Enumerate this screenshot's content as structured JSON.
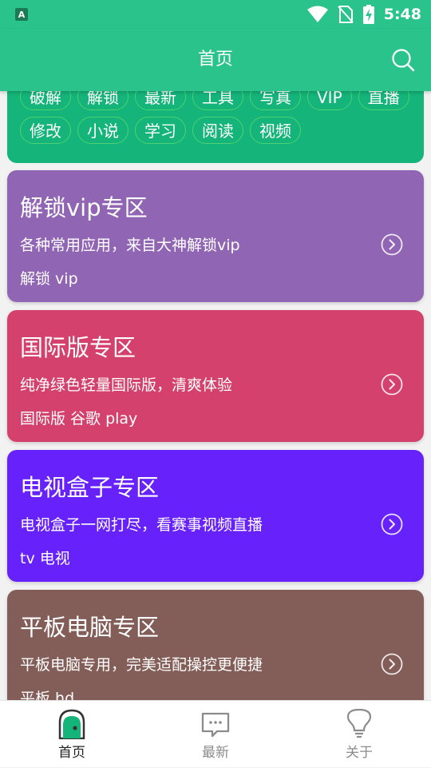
{
  "status_bar": {
    "time": "5:48"
  },
  "app_bar": {
    "title": "首页"
  },
  "tags": [
    "破解",
    "解锁",
    "最新",
    "工具",
    "写真",
    "VIP",
    "直播",
    "修改",
    "小说",
    "学习",
    "阅读",
    "视频"
  ],
  "cards": [
    {
      "title": "解锁vip专区",
      "description": "各种常用应用，来自大神解锁vip",
      "tags": "解锁 vip",
      "color": "#9065b3"
    },
    {
      "title": "国际版专区",
      "description": "纯净绿色轻量国际版，清爽体验",
      "tags": "国际版 谷歌 play",
      "color": "#d4416d"
    },
    {
      "title": "电视盒子专区",
      "description": "电视盒子一网打尽，看赛事视频直播",
      "tags": "tv 电视",
      "color": "#6721fb"
    },
    {
      "title": "平板电脑专区",
      "description": "平板电脑专用，完美适配操控更便捷",
      "tags": "平板 hd",
      "color": "#835d58"
    }
  ],
  "bottom_nav": [
    {
      "label": "首页",
      "icon": "home-icon",
      "active": true
    },
    {
      "label": "最新",
      "icon": "chat-bubble-icon",
      "active": false
    },
    {
      "label": "关于",
      "icon": "lightbulb-icon",
      "active": false
    }
  ],
  "colors": {
    "primary": "#29c38b",
    "nav_active": "#222222",
    "nav_inactive": "#8c8c8c"
  }
}
